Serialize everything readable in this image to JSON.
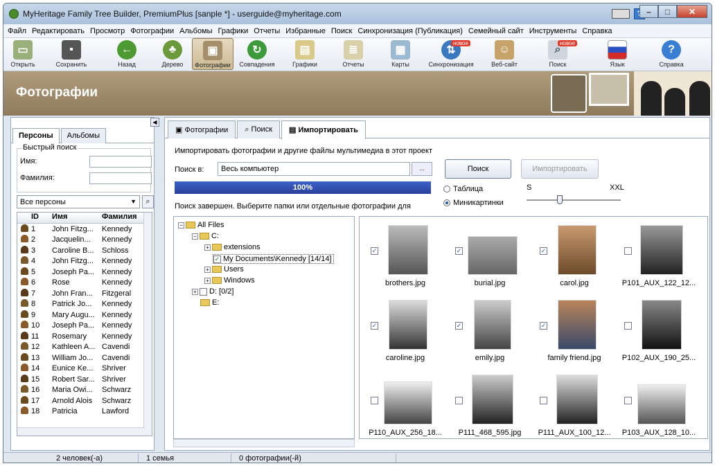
{
  "window": {
    "title": "MyHeritage Family Tree Builder, PremiumPlus [sanple *] - userguide@myheritage.com"
  },
  "menu": [
    "Файл",
    "Редактировать",
    "Просмотр",
    "Фотографии",
    "Альбомы",
    "Графики",
    "Отчеты",
    "Избранные",
    "Поиск",
    "Синхронизация (Публикация)",
    "Семейный сайт",
    "Инструменты",
    "Справка"
  ],
  "toolbar": {
    "open": "Открыть",
    "save": "Сохранить",
    "back": "Назад",
    "tree": "Дерево",
    "photos": "Фотографии",
    "matches": "Совпадения",
    "charts": "Графики",
    "reports": "Отчеты",
    "maps": "Карты",
    "sync": "Синхронизация",
    "website": "Веб-сайт",
    "search": "Поиск",
    "language": "Язык",
    "help": "Справка",
    "new_badge": "новое"
  },
  "banner": {
    "title": "Фотографии"
  },
  "left": {
    "tab_persons": "Персоны",
    "tab_albums": "Альбомы",
    "quick_search": "Быстрый поиск",
    "first_name": "Имя:",
    "last_name": "Фамилия:",
    "filter": "Все персоны",
    "columns": [
      "ID",
      "Имя",
      "Фамилия"
    ],
    "rows": [
      {
        "id": "1",
        "name": "John Fitzg...",
        "surname": "Kennedy"
      },
      {
        "id": "2",
        "name": "Jacquelin...",
        "surname": "Kennedy"
      },
      {
        "id": "3",
        "name": "Caroline B...",
        "surname": "Schloss"
      },
      {
        "id": "4",
        "name": "John Fitzg...",
        "surname": "Kennedy"
      },
      {
        "id": "5",
        "name": "Joseph Pa...",
        "surname": "Kennedy"
      },
      {
        "id": "6",
        "name": "Rose",
        "surname": "Kennedy"
      },
      {
        "id": "7",
        "name": "John Fran...",
        "surname": "Fitzgeral"
      },
      {
        "id": "8",
        "name": "Patrick Jo...",
        "surname": "Kennedy"
      },
      {
        "id": "9",
        "name": "Mary Augu...",
        "surname": "Kennedy"
      },
      {
        "id": "10",
        "name": "Joseph Pa...",
        "surname": "Kennedy"
      },
      {
        "id": "11",
        "name": "Rosemary",
        "surname": "Kennedy"
      },
      {
        "id": "12",
        "name": "Kathleen A...",
        "surname": "Cavendi"
      },
      {
        "id": "13",
        "name": "William Jo...",
        "surname": "Cavendi"
      },
      {
        "id": "14",
        "name": "Eunice Ke...",
        "surname": "Shriver"
      },
      {
        "id": "15",
        "name": "Robert Sar...",
        "surname": "Shriver"
      },
      {
        "id": "16",
        "name": "Maria Owi...",
        "surname": "Schwarz"
      },
      {
        "id": "17",
        "name": "Arnold Alois",
        "surname": "Schwarz"
      },
      {
        "id": "18",
        "name": "Patricia",
        "surname": "Lawford"
      }
    ]
  },
  "right": {
    "tabs": [
      "Фотографии",
      "Поиск",
      "Импортировать"
    ],
    "description": "Импортировать фотографии и другие файлы мультимедиа в этот проект",
    "search_in_label": "Поиск в:",
    "search_in_value": "Весь компьютер",
    "browse": "...",
    "search_button": "Поиск",
    "import_button": "Импортировать",
    "progress": "100%",
    "view_table": "Таблица",
    "view_thumbs": "Миникартинки",
    "size_min": "S",
    "size_max": "XXL",
    "status": "Поиск завершен. Выберите папки или отдельные фотографии для",
    "tree": {
      "all": "All Files",
      "c": "C:",
      "ext": "extensions",
      "mydocs": "My Documents\\Kennedy [14/14]",
      "users": "Users",
      "windows": "Windows",
      "d": "D: [0/2]",
      "e": "E:"
    },
    "files": [
      "brothers.jpg",
      "burial.jpg",
      "carol.jpg",
      "P101_AUX_122_12...",
      "caroline.jpg",
      "emily.jpg",
      "family friend.jpg",
      "P102_AUX_190_25...",
      "P110_AUX_256_18...",
      "P111_468_595.jpg",
      "P111_AUX_100_12...",
      "P103_AUX_128_10..."
    ]
  },
  "status": {
    "persons": "2 человек(-а)",
    "families": "1 семья",
    "photos": "0 фотографии(-й)"
  }
}
